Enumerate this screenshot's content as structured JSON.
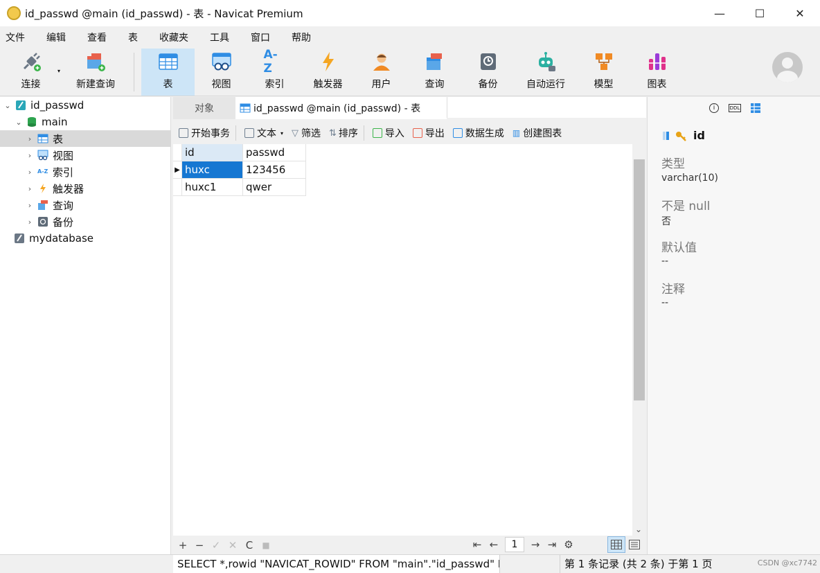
{
  "window": {
    "title": "id_passwd @main (id_passwd) - 表 - Navicat Premium",
    "controls": {
      "minimize": "—",
      "maximize": "☐",
      "close": "✕"
    }
  },
  "menu": [
    "文件",
    "编辑",
    "查看",
    "表",
    "收藏夹",
    "工具",
    "窗口",
    "帮助"
  ],
  "toolbar": {
    "connect": "连接",
    "new_query": "新建查询",
    "table": "表",
    "view": "视图",
    "index": "索引",
    "trigger": "触发器",
    "user": "用户",
    "query": "查询",
    "backup": "备份",
    "automation": "自动运行",
    "model": "模型",
    "chart": "图表",
    "index_glyph": "A-Z",
    "active": "table"
  },
  "tree": {
    "connection": "id_passwd",
    "schema": "main",
    "nodes": [
      "表",
      "视图",
      "索引",
      "触发器",
      "查询",
      "备份"
    ],
    "index_glyph": "A-Z",
    "other_db": "mydatabase"
  },
  "tabs": {
    "objects": "对象",
    "current": "id_passwd @main (id_passwd) - 表"
  },
  "subtoolbar": {
    "begin_transaction": "开始事务",
    "text": "文本",
    "filter": "筛选",
    "sort": "排序",
    "import": "导入",
    "export": "导出",
    "data_gen": "数据生成",
    "create_chart": "创建图表"
  },
  "grid": {
    "columns": [
      "id",
      "passwd"
    ],
    "rows": [
      [
        "huxc",
        "123456"
      ],
      [
        "huxc1",
        "qwer"
      ]
    ],
    "current_row_marker": "▶"
  },
  "gridfoot": {
    "actions": [
      "+",
      "−",
      "✓",
      "✕",
      "C",
      "■"
    ],
    "pager": {
      "first": "⇤",
      "prev": "←",
      "page": "1",
      "next": "→",
      "last": "⇥",
      "settings": "⚙"
    }
  },
  "rpanel": {
    "field_name": "id",
    "type_label": "类型",
    "type_value": "varchar(10)",
    "notnull_label": "不是 null",
    "notnull_value": "否",
    "default_label": "默认值",
    "default_value": "--",
    "comment_label": "注释",
    "comment_value": "--",
    "ddl_glyph": "DDL",
    "info_glyph": "i"
  },
  "status": {
    "sql": "SELECT *,rowid \"NAVICAT_ROWID\" FROM \"main\".\"id_passwd\" LI",
    "record": "第 1 条记录 (共 2 条) 于第 1 页",
    "watermark": "CSDN @xc7742"
  },
  "colors": {
    "accent": "#1677d2",
    "active_toolbar": "#cde5f7",
    "selection_tree": "#d9d9d9"
  }
}
